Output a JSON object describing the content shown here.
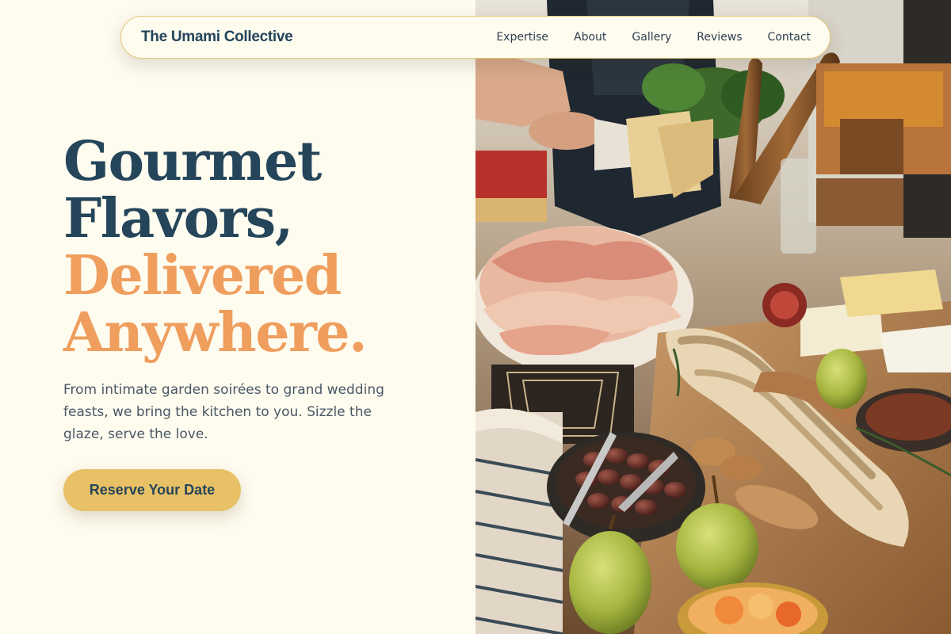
{
  "nav": {
    "brand": "The Umami Collective",
    "links": [
      "Expertise",
      "About",
      "Gallery",
      "Reviews",
      "Contact"
    ]
  },
  "hero": {
    "headline_line1": "Gourmet",
    "headline_line2": "Flavors,",
    "headline_accent_line1": "Delivered",
    "headline_accent_line2": "Anywhere.",
    "subcopy": "From intimate garden soirées to grand wedding feasts, we bring the kitchen to you. Sizzle the glaze, serve the love.",
    "cta_label": "Reserve Your Date"
  },
  "colors": {
    "background": "#fefbef",
    "primary": "#24455a",
    "accent": "#ef9e5e",
    "cta": "#e8c065",
    "nav_border": "#e6c877"
  },
  "photo": {
    "subject": "grazing-table-photo"
  }
}
